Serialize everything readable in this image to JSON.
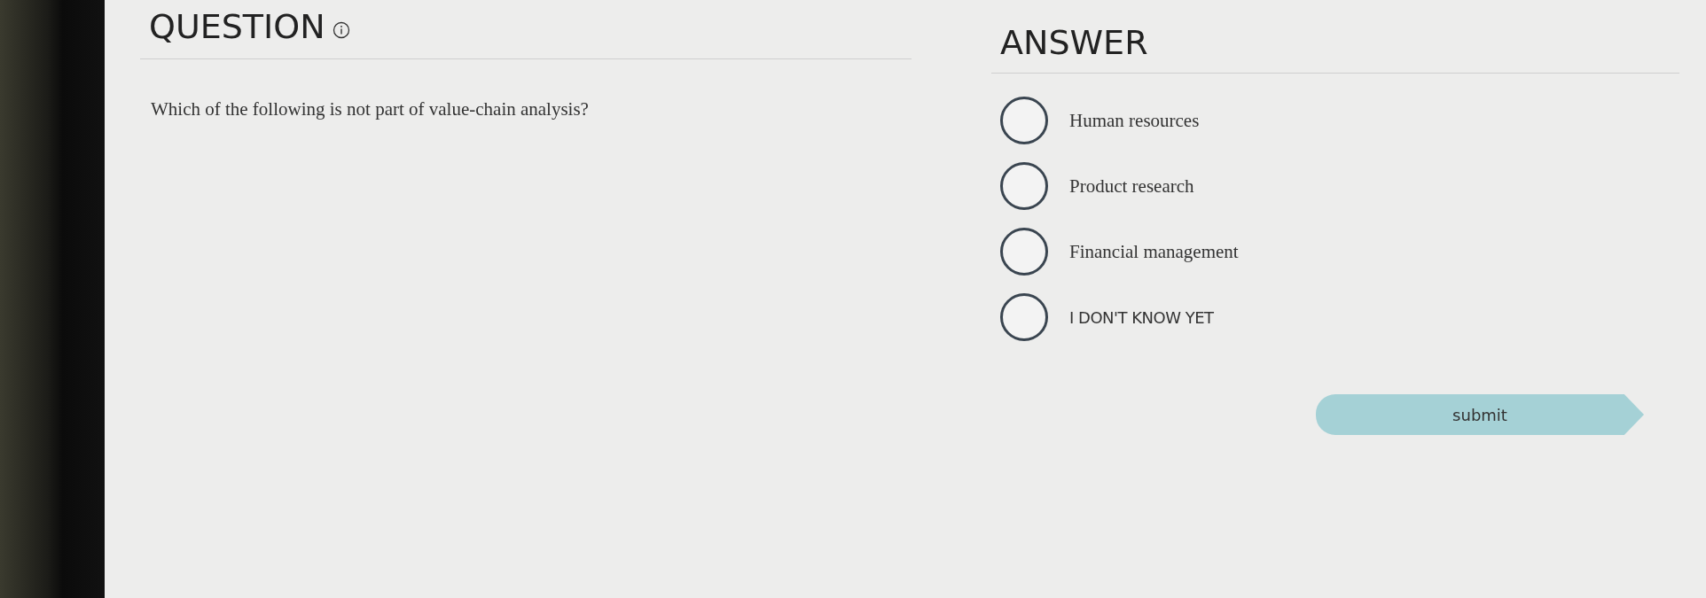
{
  "question": {
    "heading": "QUESTION",
    "text": "Which of the following is not part of value-chain analysis?"
  },
  "answer": {
    "heading": "ANSWER",
    "options": [
      {
        "label": "Human resources",
        "selected": false
      },
      {
        "label": "Product research",
        "selected": false
      },
      {
        "label": "Financial management",
        "selected": false
      },
      {
        "label": "I DON'T KNOW YET",
        "selected": false,
        "kind": "caps"
      }
    ]
  },
  "submit": {
    "label": "submit"
  }
}
